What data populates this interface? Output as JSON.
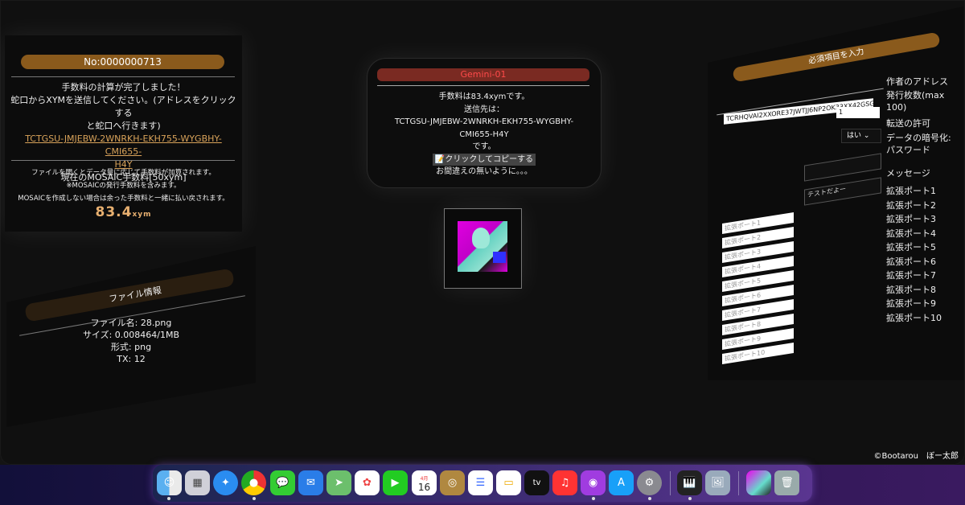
{
  "fee_panel": {
    "number_label": "No:0000000713",
    "line1": "手数料の計算が完了しました！",
    "line2": "蛇口からXYMを送信してください。(アドレスをクリックする",
    "line3": "と蛇口へ行きます)",
    "address_part1": "TCTGSU-JMJEBW-2WNRKH-EKH755-WYGBHY-CMI655-",
    "address_part2": "H4Y",
    "current_fee": "現在のMOSAIC手数料[50xym]",
    "note1": "ファイルを開くとデータ量に応じて手数料が加算されます。",
    "note2": "※MOSAICの発行手数料を含みます。",
    "note3": "MOSAICを作成しない場合は余った手数料と一緒に払い戻されます。",
    "amount": "83.4",
    "amount_unit": "xym"
  },
  "file_panel": {
    "title": "ファイル情報",
    "name": "ファイル名: 28.png",
    "size": "サイズ: 0.008464/1MB",
    "format": "形式: png",
    "tx": "TX: 12"
  },
  "gemini_panel": {
    "title": "Gemini-01",
    "line1": "手数料は83.4xymです。",
    "line2": "送信先は：",
    "address_part1": "TCTGSU-JMJEBW-2WNRKH-EKH755-WYGBHY-",
    "address_part2": "CMI655-H4Y",
    "line3": "です。",
    "copy_button": "📝クリックしてコピーする",
    "line4": "お間違えの無いように。。。"
  },
  "form_panel": {
    "header": "必須項目を入力",
    "author_address_value": "TCRHQVAI2XXORE37JWTJJ6NP2OK33XX42GSG",
    "author_address_label": "作者のアドレス",
    "issue_count_value": "1",
    "issue_count_label": "発行枚数(max 100)",
    "transfer_value": "はい",
    "transfer_label": "転送の許可",
    "encrypt_label": "データの暗号化: パスワード",
    "password_value": "",
    "message_value": "テストだよー",
    "message_label": "メッセージ",
    "ports": [
      "拡張ポート1",
      "拡張ポート2",
      "拡張ポート3",
      "拡張ポート4",
      "拡張ポート5",
      "拡張ポート6",
      "拡張ポート7",
      "拡張ポート8",
      "拡張ポート9",
      "拡張ポート10"
    ]
  },
  "credit": "©Bootarou　ぼー太郎",
  "dock": {
    "calendar_month": "4月",
    "calendar_day": "16",
    "tv_label": "tv",
    "icons": [
      "finder-icon",
      "launchpad-icon",
      "safari-icon",
      "chrome-icon",
      "messages-icon",
      "mail-icon",
      "maps-icon",
      "photos-icon",
      "facetime-icon",
      "calendar-icon",
      "keychain-icon",
      "reminders-icon",
      "notes-icon",
      "appletv-icon",
      "music-icon",
      "podcasts-icon",
      "appstore-icon",
      "settings-icon",
      "piano-icon",
      "preview-icon",
      "image-thumb-icon",
      "trash-icon"
    ]
  },
  "colors": {
    "accent_bar": "#8a5a1c",
    "gemini_bar": "#7a2a22",
    "gemini_text": "#ff4a4a",
    "address_link": "#d9a35a",
    "amount": "#e8b070"
  }
}
